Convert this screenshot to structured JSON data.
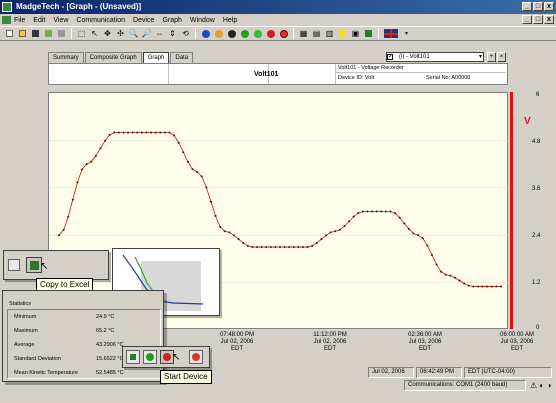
{
  "window": {
    "title": "MadgeTech - [Graph - (Unsaved)]",
    "controls": [
      "_",
      "□",
      "x"
    ]
  },
  "menu": {
    "items": [
      "File",
      "Edit",
      "View",
      "Communication",
      "Device",
      "Graph",
      "Window",
      "Help"
    ],
    "doc_controls": [
      "_",
      "□",
      "x"
    ]
  },
  "tabs": [
    "Summary",
    "Composite Graph",
    "Graph",
    "Data"
  ],
  "channel": {
    "selected": "(i) - Volt101",
    "checkbox": "✓"
  },
  "header": {
    "device_name": "Volt101",
    "description": "Volt101 - Voltage Recorder",
    "device_id": "Device ID: Volt",
    "serial": "Serial No: A00000"
  },
  "graph": {
    "unit": "V",
    "accent": "#e01010",
    "y_ticks": [
      "6",
      "4.8",
      "3.6",
      "2.4",
      "1.2",
      "0"
    ],
    "x_labels": [
      {
        "time": "07:48:00 PM",
        "date": "Jul 02, 2006",
        "tz": "EDT"
      },
      {
        "time": "11:12:00 PM",
        "date": "Jul 02, 2006",
        "tz": "EDT"
      },
      {
        "time": "02:36:00 AM",
        "date": "Jul 03, 2006",
        "tz": "EDT"
      },
      {
        "time": "06:00:00 AM",
        "date": "Jul 03, 2006",
        "tz": "EDT"
      }
    ]
  },
  "chart_data": {
    "type": "line",
    "ylim": [
      0,
      6
    ],
    "series": [
      {
        "values": [
          2.4,
          4.2,
          5.0,
          5.0,
          5.0,
          4.0,
          2.5,
          2.1,
          2.1,
          2.1,
          2.5,
          3.0,
          3.0,
          2.4,
          1.4,
          1.1,
          1.1
        ]
      }
    ]
  },
  "tooltips": {
    "copy_to_excel": "Copy to Excel",
    "start_device": "Start Device"
  },
  "stats": {
    "title": "Statistics",
    "rows": [
      {
        "label": "Minimum",
        "value": "24.9 °C"
      },
      {
        "label": "Maximum",
        "value": "65.2 °C"
      },
      {
        "label": "Average",
        "value": "43.2906 °C"
      },
      {
        "label": "Standard Deviation",
        "value": "15.6522 °C"
      },
      {
        "label": "Mean Kinetic Temperature",
        "value": "52.5485 °C"
      }
    ]
  },
  "status": {
    "date": "Jul 02, 2006",
    "time": "06:42:49 PM",
    "tz": "EDT (UTC-04:00)",
    "comm": "Communications: COM1 (2400 baud)"
  }
}
